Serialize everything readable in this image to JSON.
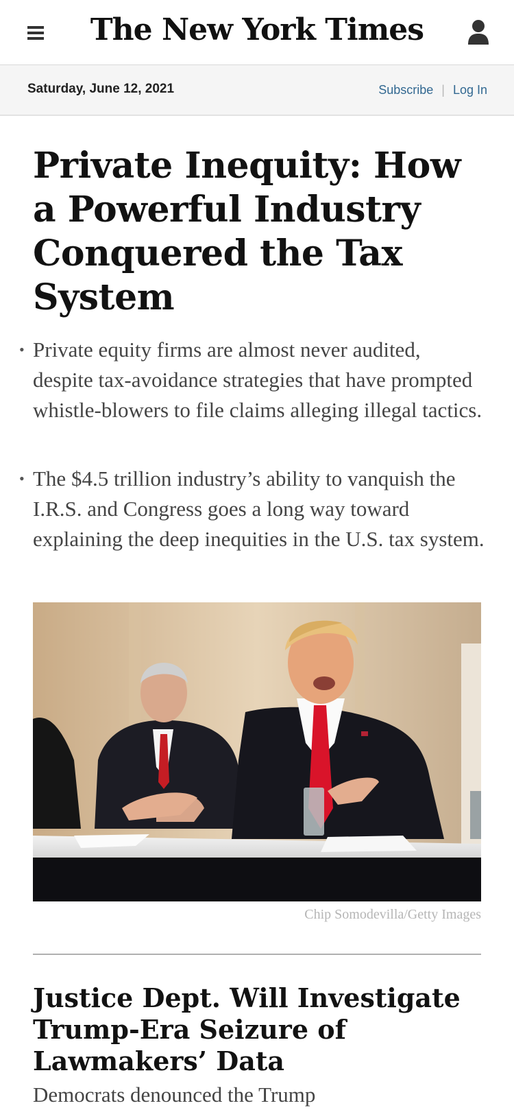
{
  "header": {
    "logo_text": "The New York Times",
    "menu_icon": "hamburger-menu-icon",
    "account_icon": "user-account-icon"
  },
  "subbar": {
    "date": "Saturday, June 12, 2021",
    "subscribe_label": "Subscribe",
    "separator": "|",
    "login_label": "Log In",
    "link_color": "#326891"
  },
  "lead_story": {
    "headline": "Private Inequity: How a Powerful Industry Conquered the Tax System",
    "summary": [
      "Private equity firms are almost never audited, despite tax-avoidance strategies that have prompted whistle-blowers to file claims alleging illegal tactics.",
      "The $4.5 trillion industry’s ability to vanquish the I.R.S. and Congress goes a long way toward explaining the deep inequities in the U.S. tax system."
    ],
    "photo_credit": "Chip Somodevilla/Getty Images"
  },
  "second_story": {
    "headline": "Justice Dept. Will Investigate Trump-Era Seizure of Lawmakers’ Data",
    "teaser": "Democrats denounced the Trump"
  }
}
